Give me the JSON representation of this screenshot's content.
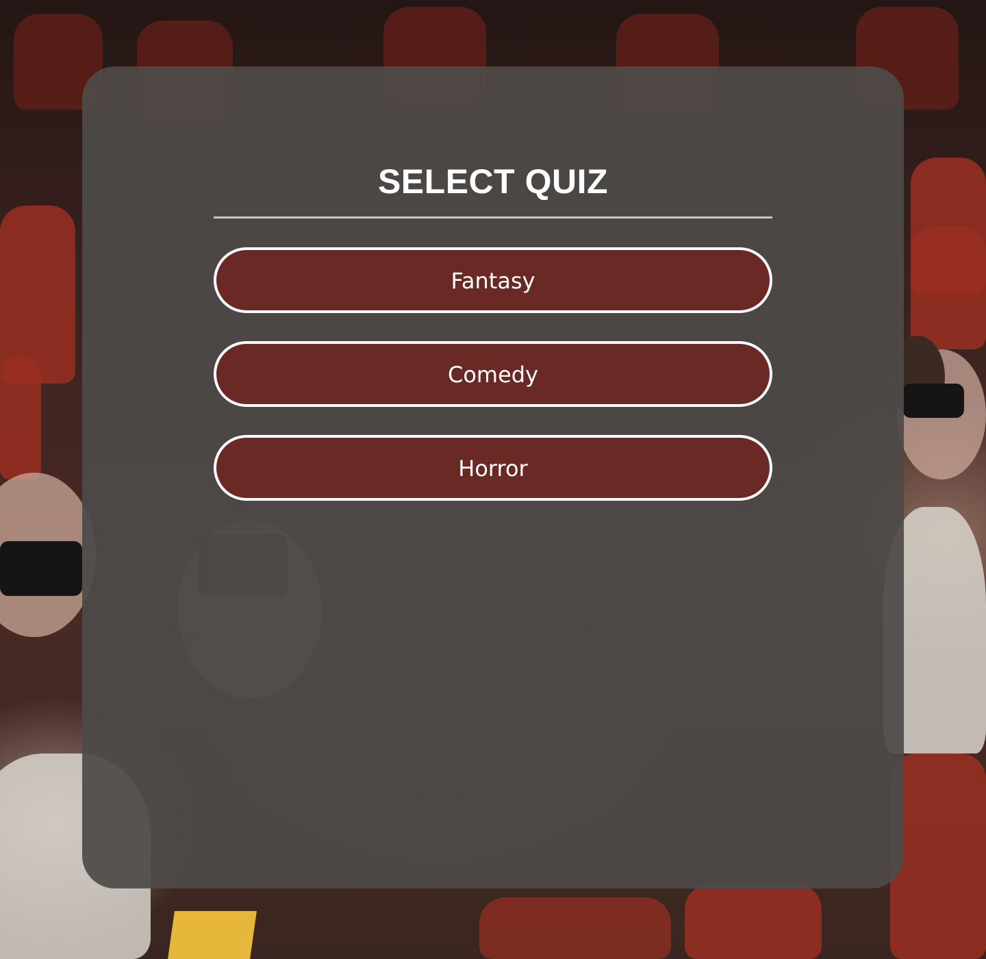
{
  "quiz_menu": {
    "title": "SELECT QUIZ",
    "options": [
      {
        "label": "Fantasy"
      },
      {
        "label": "Comedy"
      },
      {
        "label": "Horror"
      }
    ]
  },
  "colors": {
    "button_fill": "#6a2925",
    "button_border": "#ffffff",
    "card_fill": "#4e4a48",
    "title_text": "#ffffff"
  }
}
